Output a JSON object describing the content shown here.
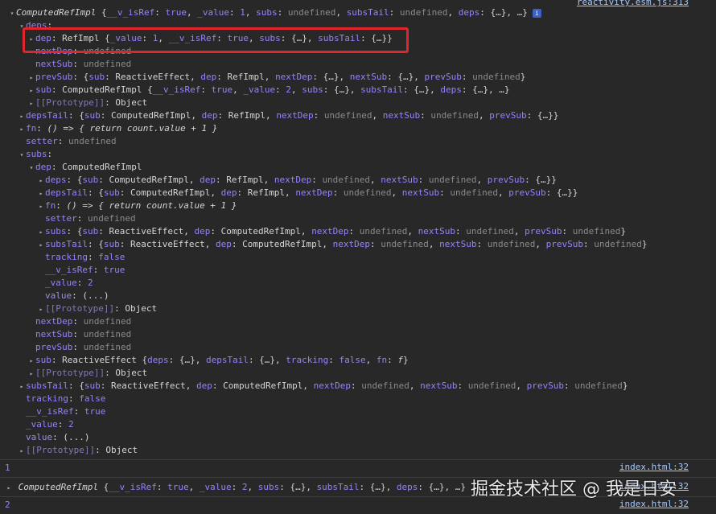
{
  "source_top": "reactivity.esm.js:313",
  "info_icon_glyph": "i",
  "lines": [
    {
      "indent": 0,
      "tw": "▾",
      "segs": [
        [
          "obj",
          "ComputedRefImpl "
        ],
        [
          "plain",
          "{"
        ],
        [
          "key",
          "__v_isRef"
        ],
        [
          "plain",
          ": "
        ],
        [
          "bool",
          "true"
        ],
        [
          "plain",
          ", "
        ],
        [
          "key",
          "_value"
        ],
        [
          "plain",
          ": "
        ],
        [
          "num",
          "1"
        ],
        [
          "plain",
          ", "
        ],
        [
          "key",
          "subs"
        ],
        [
          "plain",
          ": "
        ],
        [
          "undef",
          "undefined"
        ],
        [
          "plain",
          ", "
        ],
        [
          "key",
          "subsTail"
        ],
        [
          "plain",
          ": "
        ],
        [
          "undef",
          "undefined"
        ],
        [
          "plain",
          ", "
        ],
        [
          "key",
          "deps"
        ],
        [
          "plain",
          ": {…}, …}"
        ]
      ],
      "info": true
    },
    {
      "indent": 1,
      "tw": "▾",
      "segs": [
        [
          "key",
          "deps"
        ],
        [
          "plain",
          ":"
        ]
      ]
    },
    {
      "indent": 2,
      "tw": "▸",
      "segs": [
        [
          "key",
          "dep"
        ],
        [
          "plain",
          ": "
        ],
        [
          "val",
          "RefImpl {"
        ],
        [
          "key",
          "_value"
        ],
        [
          "plain",
          ": "
        ],
        [
          "num",
          "1"
        ],
        [
          "plain",
          ", "
        ],
        [
          "key",
          "__v_isRef"
        ],
        [
          "plain",
          ": "
        ],
        [
          "bool",
          "true"
        ],
        [
          "plain",
          ", "
        ],
        [
          "key",
          "subs"
        ],
        [
          "plain",
          ": {…}, "
        ],
        [
          "key",
          "subsTail"
        ],
        [
          "plain",
          ": {…}}"
        ]
      ]
    },
    {
      "indent": 2,
      "tw": "",
      "segs": [
        [
          "key",
          "nextDep"
        ],
        [
          "plain",
          ": "
        ],
        [
          "undef",
          "undefined"
        ]
      ]
    },
    {
      "indent": 2,
      "tw": "",
      "segs": [
        [
          "key",
          "nextSub"
        ],
        [
          "plain",
          ": "
        ],
        [
          "undef",
          "undefined"
        ]
      ]
    },
    {
      "indent": 2,
      "tw": "▸",
      "segs": [
        [
          "key",
          "prevSub"
        ],
        [
          "plain",
          ": {"
        ],
        [
          "key",
          "sub"
        ],
        [
          "plain",
          ": ReactiveEffect, "
        ],
        [
          "key",
          "dep"
        ],
        [
          "plain",
          ": RefImpl, "
        ],
        [
          "key",
          "nextDep"
        ],
        [
          "plain",
          ": {…}, "
        ],
        [
          "key",
          "nextSub"
        ],
        [
          "plain",
          ": {…}, "
        ],
        [
          "key",
          "prevSub"
        ],
        [
          "plain",
          ": "
        ],
        [
          "undef",
          "undefined"
        ],
        [
          "plain",
          "}"
        ]
      ]
    },
    {
      "indent": 2,
      "tw": "▸",
      "segs": [
        [
          "key",
          "sub"
        ],
        [
          "plain",
          ": "
        ],
        [
          "val",
          "ComputedRefImpl {"
        ],
        [
          "key",
          "__v_isRef"
        ],
        [
          "plain",
          ": "
        ],
        [
          "bool",
          "true"
        ],
        [
          "plain",
          ", "
        ],
        [
          "key",
          "_value"
        ],
        [
          "plain",
          ": "
        ],
        [
          "num",
          "2"
        ],
        [
          "plain",
          ", "
        ],
        [
          "key",
          "subs"
        ],
        [
          "plain",
          ": {…}, "
        ],
        [
          "key",
          "subsTail"
        ],
        [
          "plain",
          ": {…}, "
        ],
        [
          "key",
          "deps"
        ],
        [
          "plain",
          ": {…}, …}"
        ]
      ]
    },
    {
      "indent": 2,
      "tw": "▸",
      "segs": [
        [
          "keyd",
          "[[Prototype]]"
        ],
        [
          "plain",
          ": Object"
        ]
      ]
    },
    {
      "indent": 1,
      "tw": "▸",
      "segs": [
        [
          "key",
          "depsTail"
        ],
        [
          "plain",
          ": {"
        ],
        [
          "key",
          "sub"
        ],
        [
          "plain",
          ": ComputedRefImpl, "
        ],
        [
          "key",
          "dep"
        ],
        [
          "plain",
          ": RefImpl, "
        ],
        [
          "key",
          "nextDep"
        ],
        [
          "plain",
          ": "
        ],
        [
          "undef",
          "undefined"
        ],
        [
          "plain",
          ", "
        ],
        [
          "key",
          "nextSub"
        ],
        [
          "plain",
          ": "
        ],
        [
          "undef",
          "undefined"
        ],
        [
          "plain",
          ", "
        ],
        [
          "key",
          "prevSub"
        ],
        [
          "plain",
          ": {…}}"
        ]
      ]
    },
    {
      "indent": 1,
      "tw": "▸",
      "segs": [
        [
          "key",
          "fn"
        ],
        [
          "plain",
          ": "
        ],
        [
          "ital",
          "() => { return count.value + 1 }"
        ]
      ]
    },
    {
      "indent": 1,
      "tw": "",
      "segs": [
        [
          "key",
          "setter"
        ],
        [
          "plain",
          ": "
        ],
        [
          "undef",
          "undefined"
        ]
      ]
    },
    {
      "indent": 1,
      "tw": "▾",
      "segs": [
        [
          "key",
          "subs"
        ],
        [
          "plain",
          ":"
        ]
      ]
    },
    {
      "indent": 2,
      "tw": "▾",
      "segs": [
        [
          "key",
          "dep"
        ],
        [
          "plain",
          ": ComputedRefImpl"
        ]
      ]
    },
    {
      "indent": 3,
      "tw": "▸",
      "segs": [
        [
          "key",
          "deps"
        ],
        [
          "plain",
          ": {"
        ],
        [
          "key",
          "sub"
        ],
        [
          "plain",
          ": ComputedRefImpl, "
        ],
        [
          "key",
          "dep"
        ],
        [
          "plain",
          ": RefImpl, "
        ],
        [
          "key",
          "nextDep"
        ],
        [
          "plain",
          ": "
        ],
        [
          "undef",
          "undefined"
        ],
        [
          "plain",
          ", "
        ],
        [
          "key",
          "nextSub"
        ],
        [
          "plain",
          ": "
        ],
        [
          "undef",
          "undefined"
        ],
        [
          "plain",
          ", "
        ],
        [
          "key",
          "prevSub"
        ],
        [
          "plain",
          ": {…}}"
        ]
      ]
    },
    {
      "indent": 3,
      "tw": "▸",
      "segs": [
        [
          "key",
          "depsTail"
        ],
        [
          "plain",
          ": {"
        ],
        [
          "key",
          "sub"
        ],
        [
          "plain",
          ": ComputedRefImpl, "
        ],
        [
          "key",
          "dep"
        ],
        [
          "plain",
          ": RefImpl, "
        ],
        [
          "key",
          "nextDep"
        ],
        [
          "plain",
          ": "
        ],
        [
          "undef",
          "undefined"
        ],
        [
          "plain",
          ", "
        ],
        [
          "key",
          "nextSub"
        ],
        [
          "plain",
          ": "
        ],
        [
          "undef",
          "undefined"
        ],
        [
          "plain",
          ", "
        ],
        [
          "key",
          "prevSub"
        ],
        [
          "plain",
          ": {…}}"
        ]
      ]
    },
    {
      "indent": 3,
      "tw": "▸",
      "segs": [
        [
          "key",
          "fn"
        ],
        [
          "plain",
          ": "
        ],
        [
          "ital",
          "() => { return count.value + 1 }"
        ]
      ]
    },
    {
      "indent": 3,
      "tw": "",
      "segs": [
        [
          "key",
          "setter"
        ],
        [
          "plain",
          ": "
        ],
        [
          "undef",
          "undefined"
        ]
      ]
    },
    {
      "indent": 3,
      "tw": "▸",
      "segs": [
        [
          "key",
          "subs"
        ],
        [
          "plain",
          ": {"
        ],
        [
          "key",
          "sub"
        ],
        [
          "plain",
          ": ReactiveEffect, "
        ],
        [
          "key",
          "dep"
        ],
        [
          "plain",
          ": ComputedRefImpl, "
        ],
        [
          "key",
          "nextDep"
        ],
        [
          "plain",
          ": "
        ],
        [
          "undef",
          "undefined"
        ],
        [
          "plain",
          ", "
        ],
        [
          "key",
          "nextSub"
        ],
        [
          "plain",
          ": "
        ],
        [
          "undef",
          "undefined"
        ],
        [
          "plain",
          ", "
        ],
        [
          "key",
          "prevSub"
        ],
        [
          "plain",
          ": "
        ],
        [
          "undef",
          "undefined"
        ],
        [
          "plain",
          "}"
        ]
      ]
    },
    {
      "indent": 3,
      "tw": "▸",
      "segs": [
        [
          "key",
          "subsTail"
        ],
        [
          "plain",
          ": {"
        ],
        [
          "key",
          "sub"
        ],
        [
          "plain",
          ": ReactiveEffect, "
        ],
        [
          "key",
          "dep"
        ],
        [
          "plain",
          ": ComputedRefImpl, "
        ],
        [
          "key",
          "nextDep"
        ],
        [
          "plain",
          ": "
        ],
        [
          "undef",
          "undefined"
        ],
        [
          "plain",
          ", "
        ],
        [
          "key",
          "nextSub"
        ],
        [
          "plain",
          ": "
        ],
        [
          "undef",
          "undefined"
        ],
        [
          "plain",
          ", "
        ],
        [
          "key",
          "prevSub"
        ],
        [
          "plain",
          ": "
        ],
        [
          "undef",
          "undefined"
        ],
        [
          "plain",
          "}"
        ]
      ]
    },
    {
      "indent": 3,
      "tw": "",
      "segs": [
        [
          "key",
          "tracking"
        ],
        [
          "plain",
          ": "
        ],
        [
          "bool",
          "false"
        ]
      ]
    },
    {
      "indent": 3,
      "tw": "",
      "segs": [
        [
          "key",
          "__v_isRef"
        ],
        [
          "plain",
          ": "
        ],
        [
          "bool",
          "true"
        ]
      ]
    },
    {
      "indent": 3,
      "tw": "",
      "segs": [
        [
          "key",
          "_value"
        ],
        [
          "plain",
          ": "
        ],
        [
          "num",
          "2"
        ]
      ]
    },
    {
      "indent": 3,
      "tw": "",
      "segs": [
        [
          "keyp",
          "value"
        ],
        [
          "plain",
          ": (...)"
        ]
      ]
    },
    {
      "indent": 3,
      "tw": "▸",
      "segs": [
        [
          "keyd",
          "[[Prototype]]"
        ],
        [
          "plain",
          ": Object"
        ]
      ]
    },
    {
      "indent": 2,
      "tw": "",
      "segs": [
        [
          "key",
          "nextDep"
        ],
        [
          "plain",
          ": "
        ],
        [
          "undef",
          "undefined"
        ]
      ]
    },
    {
      "indent": 2,
      "tw": "",
      "segs": [
        [
          "key",
          "nextSub"
        ],
        [
          "plain",
          ": "
        ],
        [
          "undef",
          "undefined"
        ]
      ]
    },
    {
      "indent": 2,
      "tw": "",
      "segs": [
        [
          "key",
          "prevSub"
        ],
        [
          "plain",
          ": "
        ],
        [
          "undef",
          "undefined"
        ]
      ]
    },
    {
      "indent": 2,
      "tw": "▸",
      "segs": [
        [
          "key",
          "sub"
        ],
        [
          "plain",
          ": ReactiveEffect {"
        ],
        [
          "key",
          "deps"
        ],
        [
          "plain",
          ": {…}, "
        ],
        [
          "key",
          "depsTail"
        ],
        [
          "plain",
          ": {…}, "
        ],
        [
          "key",
          "tracking"
        ],
        [
          "plain",
          ": "
        ],
        [
          "bool",
          "false"
        ],
        [
          "plain",
          ", "
        ],
        [
          "key",
          "fn"
        ],
        [
          "plain",
          ": "
        ],
        [
          "ital",
          "f"
        ],
        [
          "plain",
          "}"
        ]
      ]
    },
    {
      "indent": 2,
      "tw": "▸",
      "segs": [
        [
          "keyd",
          "[[Prototype]]"
        ],
        [
          "plain",
          ": Object"
        ]
      ]
    },
    {
      "indent": 1,
      "tw": "▸",
      "segs": [
        [
          "key",
          "subsTail"
        ],
        [
          "plain",
          ": {"
        ],
        [
          "key",
          "sub"
        ],
        [
          "plain",
          ": ReactiveEffect, "
        ],
        [
          "key",
          "dep"
        ],
        [
          "plain",
          ": ComputedRefImpl, "
        ],
        [
          "key",
          "nextDep"
        ],
        [
          "plain",
          ": "
        ],
        [
          "undef",
          "undefined"
        ],
        [
          "plain",
          ", "
        ],
        [
          "key",
          "nextSub"
        ],
        [
          "plain",
          ": "
        ],
        [
          "undef",
          "undefined"
        ],
        [
          "plain",
          ", "
        ],
        [
          "key",
          "prevSub"
        ],
        [
          "plain",
          ": "
        ],
        [
          "undef",
          "undefined"
        ],
        [
          "plain",
          "}"
        ]
      ]
    },
    {
      "indent": 1,
      "tw": "",
      "segs": [
        [
          "key",
          "tracking"
        ],
        [
          "plain",
          ": "
        ],
        [
          "bool",
          "false"
        ]
      ]
    },
    {
      "indent": 1,
      "tw": "",
      "segs": [
        [
          "key",
          "__v_isRef"
        ],
        [
          "plain",
          ": "
        ],
        [
          "bool",
          "true"
        ]
      ]
    },
    {
      "indent": 1,
      "tw": "",
      "segs": [
        [
          "key",
          "_value"
        ],
        [
          "plain",
          ": "
        ],
        [
          "num",
          "2"
        ]
      ]
    },
    {
      "indent": 1,
      "tw": "",
      "segs": [
        [
          "keyp",
          "value"
        ],
        [
          "plain",
          ": (...)"
        ]
      ]
    },
    {
      "indent": 1,
      "tw": "▸",
      "segs": [
        [
          "keyd",
          "[[Prototype]]"
        ],
        [
          "plain",
          ": Object"
        ]
      ]
    }
  ],
  "log1": {
    "text": "1",
    "source": "index.html:32"
  },
  "log2": {
    "segs": [
      [
        "obj",
        "ComputedRefImpl "
      ],
      [
        "plain",
        "{"
      ],
      [
        "key",
        "__v_isRef"
      ],
      [
        "plain",
        ": "
      ],
      [
        "bool",
        "true"
      ],
      [
        "plain",
        ", "
      ],
      [
        "key",
        "_value"
      ],
      [
        "plain",
        ": "
      ],
      [
        "num",
        "2"
      ],
      [
        "plain",
        ", "
      ],
      [
        "key",
        "subs"
      ],
      [
        "plain",
        ": {…}, "
      ],
      [
        "key",
        "subsTail"
      ],
      [
        "plain",
        ": {…}, "
      ],
      [
        "key",
        "deps"
      ],
      [
        "plain",
        ": {…}, …}"
      ]
    ],
    "source": "index.html:32"
  },
  "log3": {
    "text": "2",
    "source": "index.html:32"
  },
  "watermark": "掘金技术社区 @ 我是日安"
}
